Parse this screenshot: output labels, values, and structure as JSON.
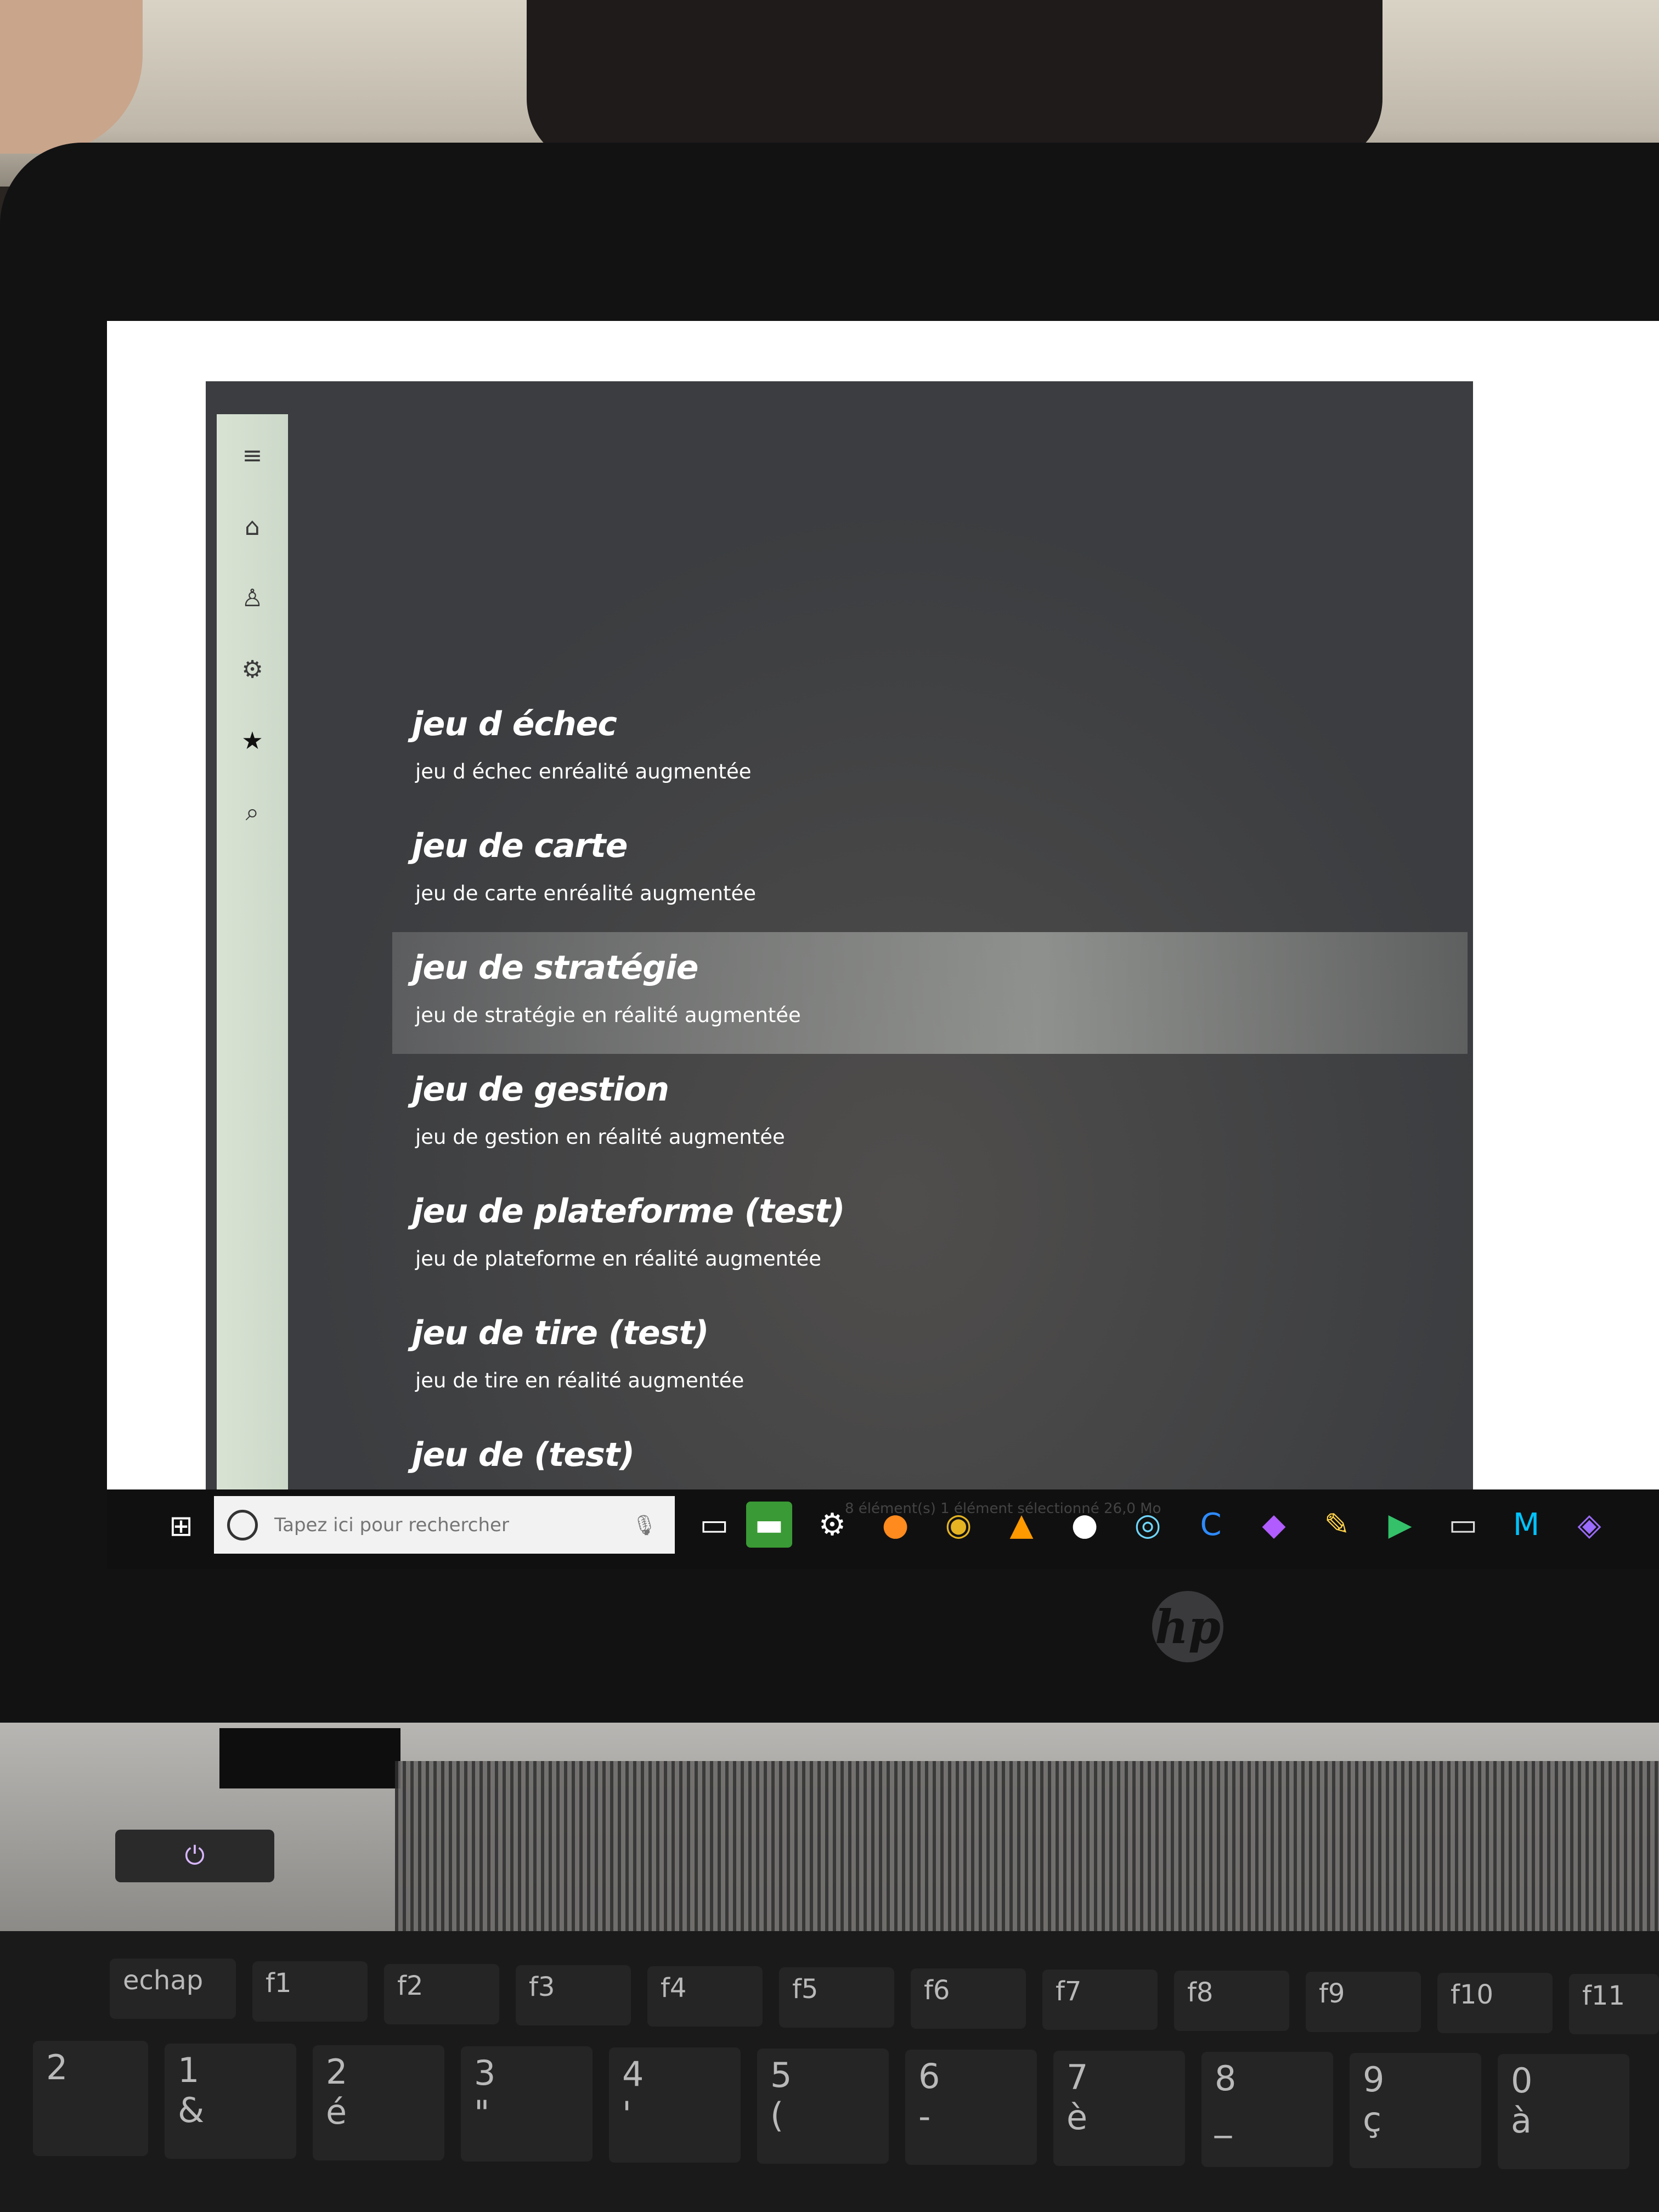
{
  "nav": {
    "items": [
      {
        "name": "menu",
        "glyph": "≡"
      },
      {
        "name": "home",
        "glyph": "⌂"
      },
      {
        "name": "profile",
        "glyph": "♙"
      },
      {
        "name": "settings",
        "glyph": "⚙"
      },
      {
        "name": "favorites",
        "glyph": "★"
      },
      {
        "name": "search",
        "glyph": "⌕"
      }
    ]
  },
  "games": [
    {
      "title": "jeu d échec",
      "subtitle": "jeu d échec enréalité augmentée"
    },
    {
      "title": "jeu de carte",
      "subtitle": "jeu de carte enréalité augmentée"
    },
    {
      "title": "jeu de stratégie",
      "subtitle": "jeu de stratégie en réalité augmentée",
      "selected": true
    },
    {
      "title": "jeu de gestion",
      "subtitle": "jeu de gestion en réalité augmentée"
    },
    {
      "title": "jeu de plateforme (test)",
      "subtitle": "jeu de plateforme en réalité augmentée"
    },
    {
      "title": "jeu de tire (test)",
      "subtitle": "jeu de tire en réalité augmentée"
    },
    {
      "title": "jeu de (test)",
      "subtitle": ""
    }
  ],
  "taskbar": {
    "search_placeholder": "Tapez ici pour rechercher",
    "status_text": "8 élément(s)   1 élément sélectionné  26,0 Mo",
    "icons": [
      "task-view-icon",
      "file-explorer-icon",
      "settings-icon",
      "firefox-icon",
      "chrome-icon",
      "vlc-icon",
      "app-icon",
      "unity-hub-icon",
      "ccleaner-icon",
      "visual-studio-icon",
      "sticky-notes-icon",
      "play-store-icon",
      "window-icon",
      "matlab-icon",
      "visual-studio-code-icon"
    ]
  },
  "hardware": {
    "brand": "hp",
    "function_keys": [
      "echap",
      "f1",
      "f2",
      "f3",
      "f4",
      "f5",
      "f6",
      "f7",
      "f8",
      "f9",
      "f10",
      "f11"
    ],
    "number_keys": [
      {
        "top": "",
        "bottom": "2"
      },
      {
        "top": "1",
        "bottom": "&"
      },
      {
        "top": "2",
        "bottom": "é"
      },
      {
        "top": "3",
        "bottom": "\""
      },
      {
        "top": "4",
        "bottom": "'"
      },
      {
        "top": "5",
        "bottom": "("
      },
      {
        "top": "6",
        "bottom": "-"
      },
      {
        "top": "7",
        "bottom": "è"
      },
      {
        "top": "8",
        "bottom": "_"
      },
      {
        "top": "9",
        "bottom": "ç"
      },
      {
        "top": "0",
        "bottom": "à"
      }
    ]
  }
}
